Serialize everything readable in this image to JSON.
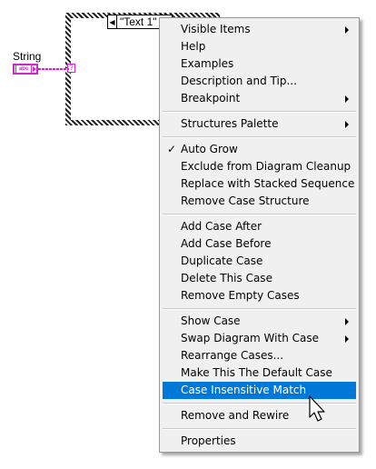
{
  "diagram": {
    "case_selector_value": "\"Text 1\"",
    "string_label": "String",
    "string_terminal_text": "abc",
    "selector_terminal_text": "?"
  },
  "context_menu": {
    "items": [
      {
        "label": "Visible Items",
        "submenu": true
      },
      {
        "label": "Help"
      },
      {
        "label": "Examples"
      },
      {
        "label": "Description and Tip..."
      },
      {
        "label": "Breakpoint",
        "submenu": true
      },
      {
        "label": "Structures Palette",
        "submenu": true
      },
      {
        "label": "Auto Grow",
        "checked": true
      },
      {
        "label": "Exclude from Diagram Cleanup"
      },
      {
        "label": "Replace with Stacked Sequence"
      },
      {
        "label": "Remove Case Structure"
      },
      {
        "label": "Add Case After"
      },
      {
        "label": "Add Case Before"
      },
      {
        "label": "Duplicate Case"
      },
      {
        "label": "Delete This Case"
      },
      {
        "label": "Remove Empty Cases"
      },
      {
        "label": "Show Case",
        "submenu": true
      },
      {
        "label": "Swap Diagram With Case",
        "submenu": true
      },
      {
        "label": "Rearrange Cases..."
      },
      {
        "label": "Make This The Default Case"
      },
      {
        "label": "Case Insensitive Match",
        "highlighted": true
      },
      {
        "label": "Remove and Rewire"
      },
      {
        "label": "Properties"
      }
    ],
    "check_glyph": "✓",
    "highlight_color": "#0078d7"
  }
}
